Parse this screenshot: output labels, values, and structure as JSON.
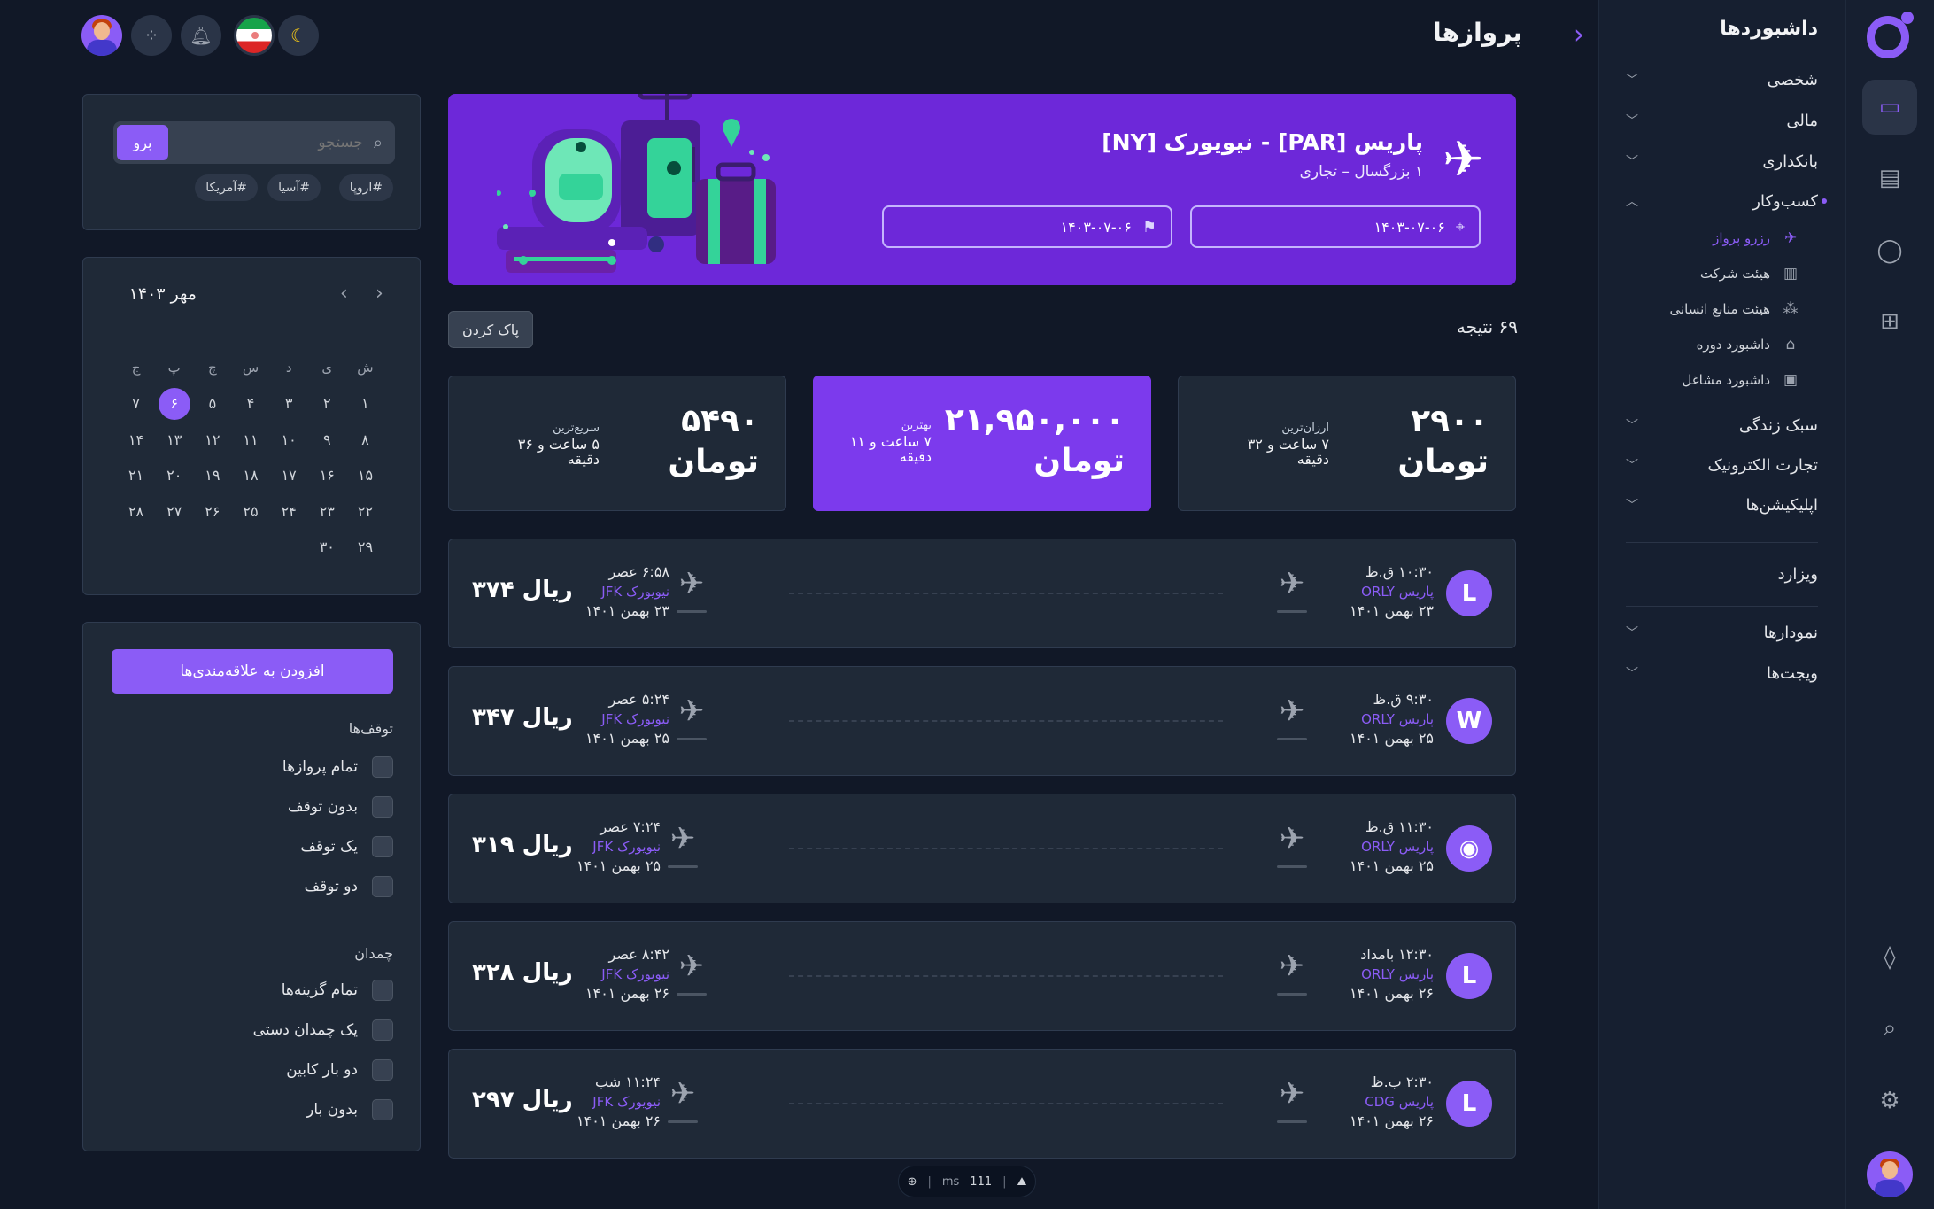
{
  "sidebar": {
    "title": "داشبوردها",
    "items": [
      {
        "label": "شخصی"
      },
      {
        "label": "مالی"
      },
      {
        "label": "بانکداری"
      },
      {
        "label": "کسب‌وکار"
      },
      {
        "label": "سبک زندگی"
      },
      {
        "label": "تجارت الکترونیک"
      },
      {
        "label": "اپلیکیشن‌ها"
      }
    ],
    "sub_items": [
      {
        "label": "رزرو پرواز",
        "icon": "plane-icon"
      },
      {
        "label": "هیئت شرکت",
        "icon": "building-icon"
      },
      {
        "label": "هیئت منابع انسانی",
        "icon": "people-icon"
      },
      {
        "label": "داشبورد دوره",
        "icon": "graduation-cap-icon"
      },
      {
        "label": "داشبورد مشاغل",
        "icon": "briefcase-icon"
      }
    ],
    "wizard": "ویزارد",
    "charts": "نمودارها",
    "widgets": "ویجت‌ها"
  },
  "header": {
    "title": "پروازها"
  },
  "banner": {
    "route": "پاریس [PAR] - نیویورک [NY]",
    "passengers": "۱ بزرگسال – تجاری",
    "depart_date": "۱۴۰۳-۰۷-۰۶",
    "return_date": "۱۴۰۳-۰۷-۰۶"
  },
  "search": {
    "placeholder": "جستجو",
    "go": "برو",
    "tags": [
      "#اروپا",
      "#آسیا",
      "#آمریکا"
    ]
  },
  "calendar": {
    "month": "مهر ۱۴۰۳",
    "weekdays": [
      "ش",
      "ی",
      "د",
      "س",
      "چ",
      "پ",
      "ج"
    ],
    "days": [
      "1",
      "2",
      "3",
      "4",
      "5",
      "6",
      "7",
      "8",
      "9",
      "10",
      "11",
      "12",
      "13",
      "14",
      "15",
      "16",
      "17",
      "18",
      "19",
      "20",
      "21",
      "22",
      "23",
      "24",
      "25",
      "26",
      "27",
      "28",
      "29",
      "30"
    ],
    "days_fa": [
      "۱",
      "۲",
      "۳",
      "۴",
      "۵",
      "۶",
      "۷",
      "۸",
      "۹",
      "۱۰",
      "۱۱",
      "۱۲",
      "۱۳",
      "۱۴",
      "۱۵",
      "۱۶",
      "۱۷",
      "۱۸",
      "۱۹",
      "۲۰",
      "۲۱",
      "۲۲",
      "۲۳",
      "۲۴",
      "۲۵",
      "۲۶",
      "۲۷",
      "۲۸",
      "۲۹",
      "۳۰"
    ],
    "selected_day": "۶"
  },
  "filters": {
    "add_fav": "افزودن به علاقه‌مندی‌ها",
    "stops_title": "توقف‌ها",
    "stops": [
      "تمام پروازها",
      "بدون توقف",
      "یک توقف",
      "دو توقف"
    ],
    "bags_title": "چمدان",
    "bags": [
      "تمام گزینه‌ها",
      "یک چمدان دستی",
      "دو بار کابین",
      "بدون بار"
    ]
  },
  "results": {
    "count": "۶۹ نتیجه",
    "clear": "پاک کردن"
  },
  "stats": [
    {
      "price": "۲۹۰۰",
      "currency": "تومان",
      "title": "ارزان‌ترین",
      "duration": "۷ ساعت و ۳۲ دقیقه"
    },
    {
      "price": "۲۱,۹۵۰,۰۰۰",
      "currency": "تومان",
      "title": "بهترین",
      "duration": "۷ ساعت و ۱۱ دقیقه"
    },
    {
      "price": "۵۴۹۰",
      "currency": "تومان",
      "title": "سریع‌ترین",
      "duration": "۵ ساعت و ۳۶ دقیقه"
    }
  ],
  "flights": [
    {
      "logo": "L",
      "dep_time": "۱۰:۳۰ ق.ظ",
      "dep_airport": "پاریس ORLY",
      "dep_date": "۲۳ بهمن ۱۴۰۱",
      "arr_time": "۶:۵۸ عصر",
      "arr_airport": "نیویورک JFK",
      "arr_date": "۲۳ بهمن ۱۴۰۱",
      "price": "ریال ۳۷۴"
    },
    {
      "logo": "W",
      "dep_time": "۹:۳۰ ق.ظ",
      "dep_airport": "پاریس ORLY",
      "dep_date": "۲۵ بهمن ۱۴۰۱",
      "arr_time": "۵:۲۴ عصر",
      "arr_airport": "نیویورک JFK",
      "arr_date": "۲۵ بهمن ۱۴۰۱",
      "price": "ریال ۳۴۷"
    },
    {
      "logo": "◉",
      "dep_time": "۱۱:۳۰ ق.ظ",
      "dep_airport": "پاریس ORLY",
      "dep_date": "۲۵ بهمن ۱۴۰۱",
      "arr_time": "۷:۲۴ عصر",
      "arr_airport": "نیویورک JFK",
      "arr_date": "۲۵ بهمن ۱۴۰۱",
      "price": "ریال ۳۱۹"
    },
    {
      "logo": "L",
      "dep_time": "۱۲:۳۰ بامداد",
      "dep_airport": "پاریس ORLY",
      "dep_date": "۲۶ بهمن ۱۴۰۱",
      "arr_time": "۸:۴۲ عصر",
      "arr_airport": "نیویورک JFK",
      "arr_date": "۲۶ بهمن ۱۴۰۱",
      "price": "ریال ۳۲۸"
    },
    {
      "logo": "L",
      "dep_time": "۲:۳۰ ب.ظ",
      "dep_airport": "پاریس CDG",
      "dep_date": "۲۶ بهمن ۱۴۰۱",
      "arr_time": "۱۱:۲۴ شب",
      "arr_airport": "نیویورک JFK",
      "arr_date": "۲۶ بهمن ۱۴۰۱",
      "price": "ریال ۲۹۷"
    }
  ],
  "perf": {
    "ms_label": "ms",
    "ms_value": "111"
  },
  "colors": {
    "accent": "#8b5cf6",
    "banner": "#6d28d9",
    "background": "#111827",
    "card": "#1f2937"
  }
}
